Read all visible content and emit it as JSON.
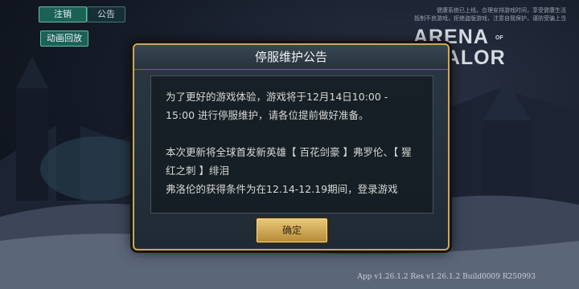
{
  "top_tabs": {
    "logout": "注销",
    "notice": "公告",
    "replay": "动画回放"
  },
  "health_notice": "健康系统已上线，合理安排游戏时间，享受健康生活\n抵制不良游戏，拒绝盗版游戏，注意自我保护，谨防受骗上当",
  "logo": {
    "line1": "ARENA",
    "of": "OF",
    "line2": "VALOR"
  },
  "dialog": {
    "title": "停服维护公告",
    "body": "为了更好的游戏体验，游戏将于12月14日10:00 - 15:00 进行停服维护，请各位提前做好准备。\n\n本次更新将全球首发新英雄【 百花剑豪 】弗罗伦、【 猩红之刺 】绯泪\n弗洛伦的获得条件为在12.14-12.19期间，登录游戏",
    "confirm_label": "确定"
  },
  "version": "App v1.26.1.2 Res v1.26.1.2 Build0009 R250993"
}
